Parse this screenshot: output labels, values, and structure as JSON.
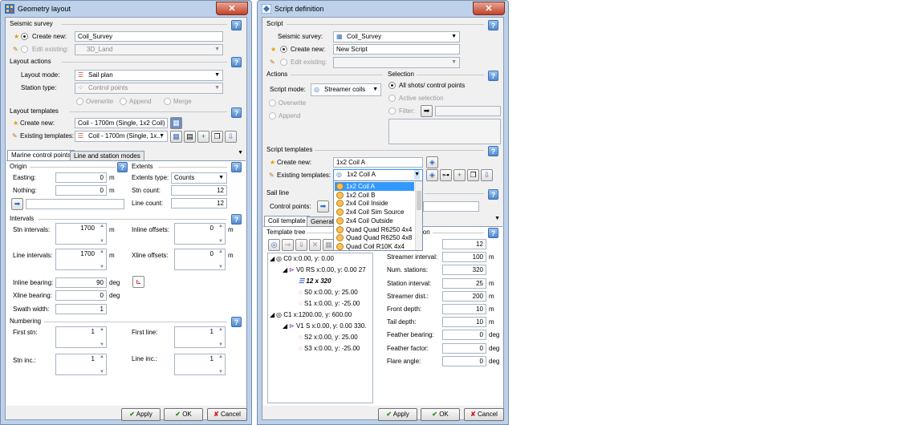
{
  "left": {
    "title": "Geometry layout",
    "seismic_survey": {
      "label": "Seismic survey",
      "create_new": "Create new:",
      "create_value": "Coil_Survey",
      "edit_existing": "Edit existing:",
      "edit_value": "3D_Land"
    },
    "layout_actions": {
      "label": "Layout actions",
      "layout_mode_label": "Layout mode:",
      "layout_mode": "Sail plan",
      "station_type_label": "Station type:",
      "station_type": "Control points",
      "overwrite": "Overwrite",
      "append": "Append",
      "merge": "Merge"
    },
    "layout_templates": {
      "label": "Layout templates",
      "create_new": "Create new:",
      "create_value": "Coil - 1700m (Single, 1x2 Coil)",
      "existing": "Existing templates:",
      "existing_value": "Coil - 1700m (Single, 1x..."
    },
    "tabs": [
      "Marine control points",
      "Line and station modes"
    ],
    "origin": {
      "label": "Origin",
      "easting_label": "Easting:",
      "easting": "0",
      "nothing_label": "Nothing:",
      "nothing": "0",
      "unit": "m"
    },
    "extents": {
      "label": "Extents",
      "type_label": "Extents type:",
      "type": "Counts",
      "stn_label": "Stn count:",
      "stn": "12",
      "line_label": "Line count:",
      "line": "12"
    },
    "intervals": {
      "label": "Intervals",
      "stn_label": "Stn intervals:",
      "stn": "1700",
      "inline_label": "Inline offsets:",
      "inline": "0",
      "line_label": "Line intervals:",
      "line": "1700",
      "xline_label": "Xline offsets:",
      "xline": "0",
      "inline_bearing_label": "Inline bearing:",
      "inline_bearing": "90",
      "xline_bearing_label": "Xline bearing:",
      "xline_bearing": "0",
      "swath_label": "Swath width:",
      "swath": "1",
      "unit_m": "m",
      "unit_deg": "deg"
    },
    "numbering": {
      "label": "Numbering",
      "first_stn_label": "First stn:",
      "first_stn": "1",
      "first_line_label": "First line:",
      "first_line": "1",
      "stn_inc_label": "Stn inc.:",
      "stn_inc": "1",
      "line_inc_label": "Line inc.:",
      "line_inc": "1"
    },
    "buttons": {
      "apply": "Apply",
      "ok": "OK",
      "cancel": "Cancel"
    }
  },
  "right": {
    "title": "Script definition",
    "script": {
      "label": "Script",
      "survey_label": "Seismic survey:",
      "survey": "Coil_Survey",
      "create_new": "Create new:",
      "create_value": "New Script",
      "edit_existing": "Edit existing:"
    },
    "actions": {
      "label": "Actions",
      "mode_label": "Script mode:",
      "mode": "Streamer coils",
      "overwrite": "Overwrite",
      "append": "Append"
    },
    "selection": {
      "label": "Selection",
      "all": "All shots/ control points",
      "active": "Active selection",
      "filter": "Filter:"
    },
    "templates": {
      "label": "Script templates",
      "create_new": "Create new:",
      "create_value": "1x2 Coil A",
      "existing": "Existing templates:",
      "existing_value": "1x2 Coil A"
    },
    "dropdown_items": [
      "1x2 Coil A",
      "1x2 Coil B",
      "2x4 Coil Inside",
      "2x4 Coil Sim Source",
      "2x4 Coil Outside",
      "Quad Quad R6250 4x4",
      "Quad Quad R6250 4x8",
      "Quad Coil R10K 4x4"
    ],
    "sail_line": {
      "label": "Sail line",
      "control_points": "Control points:"
    },
    "tabs": [
      "Coil template",
      "General"
    ],
    "tree_label": "Template tree",
    "tree": {
      "c0": "C0 x:0.00, y: 0.00",
      "v0": "V0 RS x:0.00, y: 0.00 27",
      "grid": "12 x 320",
      "s0": "S0 x:0.00, y: 25.00",
      "s1": "S1 x:0.00, y: -25.00",
      "c1": "C1 x:1200.00, y: 600.00",
      "v1": "V1  S x:0.00, y: 0.00 330.",
      "s2": "S2 x:0.00, y: 25.00",
      "s3": "S3 x:0.00, y: -25.00"
    },
    "props_label": "ion",
    "props": [
      {
        "label": "",
        "value": "12",
        "unit": ""
      },
      {
        "label": "Streamer interval:",
        "value": "100",
        "unit": "m"
      },
      {
        "label": "Num. stations:",
        "value": "320",
        "unit": ""
      },
      {
        "label": "Station interval:",
        "value": "25",
        "unit": "m"
      },
      {
        "label": "Streamer dist.:",
        "value": "200",
        "unit": "m"
      },
      {
        "label": "Front depth:",
        "value": "10",
        "unit": "m"
      },
      {
        "label": "Tail depth:",
        "value": "10",
        "unit": "m"
      },
      {
        "label": "Feather bearing:",
        "value": "0",
        "unit": "deg"
      },
      {
        "label": "Feather factor:",
        "value": "0",
        "unit": "deg"
      },
      {
        "label": "Flare angle:",
        "value": "0",
        "unit": "deg"
      }
    ],
    "buttons": {
      "apply": "Apply",
      "ok": "OK",
      "cancel": "Cancel"
    }
  },
  "close_glyph": "✕",
  "help_glyph": "?"
}
